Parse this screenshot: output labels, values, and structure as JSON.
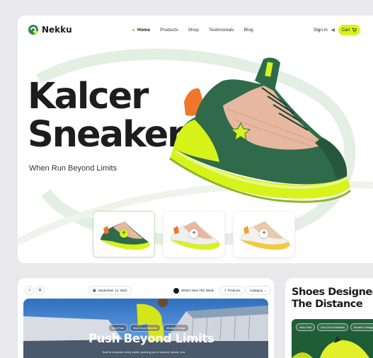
{
  "brand": {
    "name": "Nekku",
    "logo_icon": "leaf-logo-icon"
  },
  "nav": {
    "items": [
      {
        "label": "Home",
        "active": true
      },
      {
        "label": "Products",
        "active": false
      },
      {
        "label": "Shop",
        "active": false
      },
      {
        "label": "Testimonials",
        "active": false
      },
      {
        "label": "Blog",
        "active": false
      }
    ],
    "signin_label": "Sign in",
    "cart_label": "Cart"
  },
  "hero": {
    "title_line1": "Kalcer",
    "title_line2": "Sneakers",
    "tagline": "When Run Beyond Limits"
  },
  "thumbnails": [
    {
      "variant": "green-lime",
      "selected": true
    },
    {
      "variant": "white-lime",
      "selected": false
    },
    {
      "variant": "white-yellow",
      "selected": false
    }
  ],
  "card2": {
    "date": "September 13, 2023",
    "whats_new": "What's New This Week",
    "products_label": "Products",
    "category_label": "Category",
    "tags": [
      "Very Fast",
      "Very Good Material",
      "Modern Design"
    ],
    "title": "Push Beyond Limits",
    "subtitle": "Built to empower every stride, pushing you in comfort, speed, and"
  },
  "card3": {
    "title_line1": "Shoes Designed",
    "title_line2": "The Distance",
    "tags": [
      "Very Fast",
      "Very Good Material",
      "Modern Design"
    ]
  },
  "colors": {
    "accent_lime": "#d6f31a",
    "dark_green": "#2f6b4a",
    "orange": "#f0762b",
    "background": "#e9e9ec"
  }
}
